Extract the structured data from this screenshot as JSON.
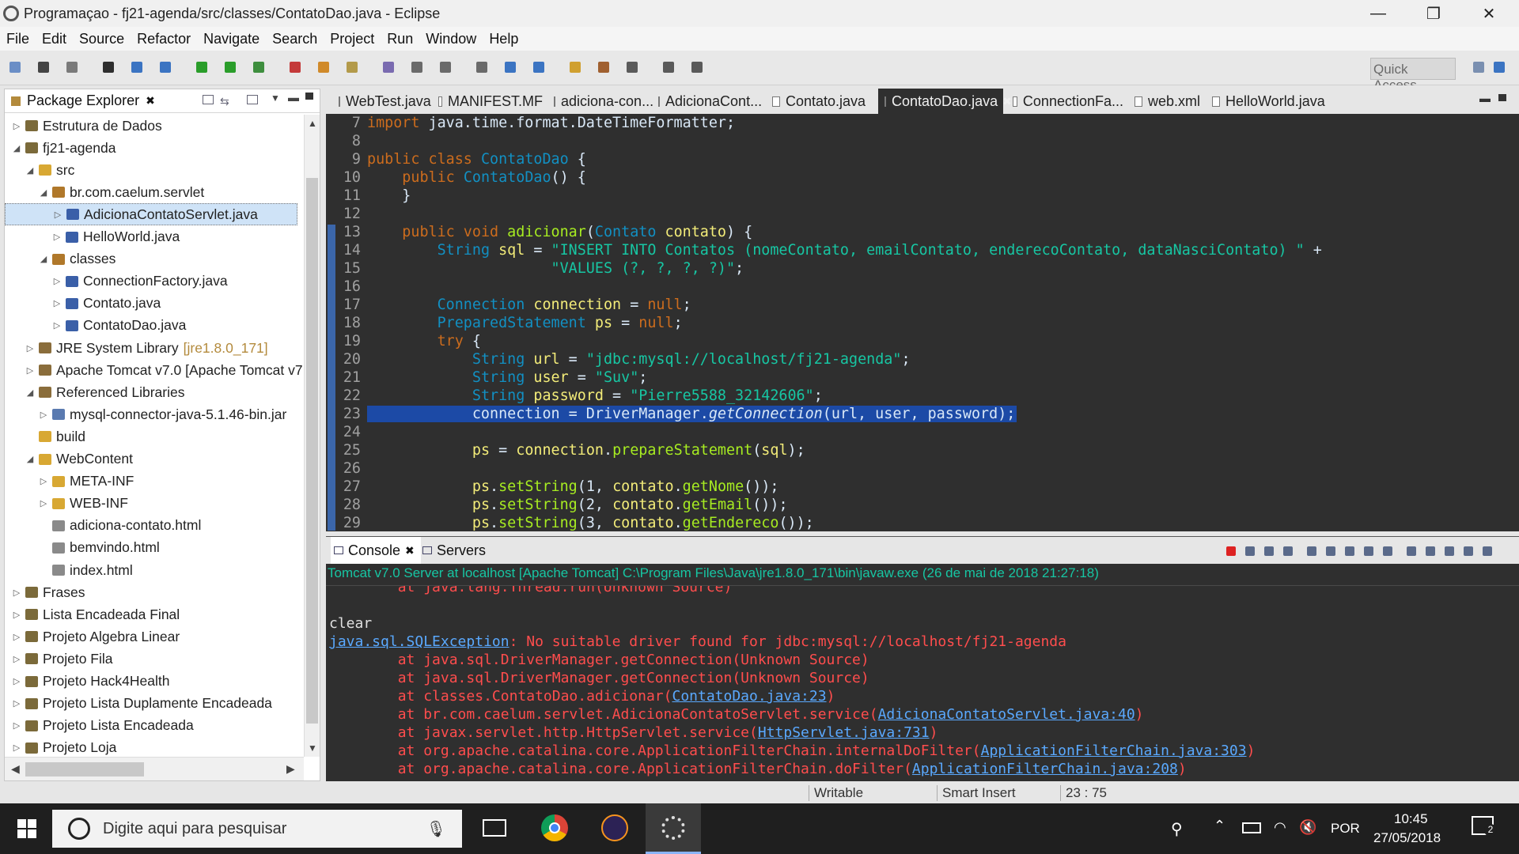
{
  "window": {
    "title": "Programaçao - fj21-agenda/src/classes/ContatoDao.java - Eclipse"
  },
  "menu": [
    "File",
    "Edit",
    "Source",
    "Refactor",
    "Navigate",
    "Search",
    "Project",
    "Run",
    "Window",
    "Help"
  ],
  "toolbar": {
    "quick_access": "Quick Access"
  },
  "package_explorer": {
    "title": "Package Explorer",
    "items": [
      {
        "label": "Estrutura de Dados",
        "indent": 0,
        "arrow": "▷",
        "icon": "project"
      },
      {
        "label": "fj21-agenda",
        "indent": 0,
        "arrow": "◢",
        "icon": "project"
      },
      {
        "label": "src",
        "indent": 1,
        "arrow": "◢",
        "icon": "folder"
      },
      {
        "label": "br.com.caelum.servlet",
        "indent": 2,
        "arrow": "◢",
        "icon": "package"
      },
      {
        "label": "AdicionaContatoServlet.java",
        "indent": 3,
        "arrow": "▷",
        "icon": "java",
        "selected": true
      },
      {
        "label": "HelloWorld.java",
        "indent": 3,
        "arrow": "▷",
        "icon": "java"
      },
      {
        "label": "classes",
        "indent": 2,
        "arrow": "◢",
        "icon": "package"
      },
      {
        "label": "ConnectionFactory.java",
        "indent": 3,
        "arrow": "▷",
        "icon": "java"
      },
      {
        "label": "Contato.java",
        "indent": 3,
        "arrow": "▷",
        "icon": "java"
      },
      {
        "label": "ContatoDao.java",
        "indent": 3,
        "arrow": "▷",
        "icon": "java"
      },
      {
        "label": "JRE System Library",
        "extra": "[jre1.8.0_171]",
        "indent": 1,
        "arrow": "▷",
        "icon": "library"
      },
      {
        "label": "Apache Tomcat v7.0 [Apache Tomcat v7",
        "indent": 1,
        "arrow": "▷",
        "icon": "library"
      },
      {
        "label": "Referenced Libraries",
        "indent": 1,
        "arrow": "◢",
        "icon": "library"
      },
      {
        "label": "mysql-connector-java-5.1.46-bin.jar",
        "indent": 2,
        "arrow": "▷",
        "icon": "jar"
      },
      {
        "label": "build",
        "indent": 1,
        "arrow": "",
        "icon": "folder"
      },
      {
        "label": "WebContent",
        "indent": 1,
        "arrow": "◢",
        "icon": "folder"
      },
      {
        "label": "META-INF",
        "indent": 2,
        "arrow": "▷",
        "icon": "folder"
      },
      {
        "label": "WEB-INF",
        "indent": 2,
        "arrow": "▷",
        "icon": "folder"
      },
      {
        "label": "adiciona-contato.html",
        "indent": 2,
        "arrow": "",
        "icon": "file"
      },
      {
        "label": "bemvindo.html",
        "indent": 2,
        "arrow": "",
        "icon": "file"
      },
      {
        "label": "index.html",
        "indent": 2,
        "arrow": "",
        "icon": "file"
      },
      {
        "label": "Frases",
        "indent": 0,
        "arrow": "▷",
        "icon": "project"
      },
      {
        "label": "Lista Encadeada Final",
        "indent": 0,
        "arrow": "▷",
        "icon": "project"
      },
      {
        "label": "Projeto Algebra Linear",
        "indent": 0,
        "arrow": "▷",
        "icon": "project"
      },
      {
        "label": "Projeto Fila",
        "indent": 0,
        "arrow": "▷",
        "icon": "project"
      },
      {
        "label": "Projeto Hack4Health",
        "indent": 0,
        "arrow": "▷",
        "icon": "project"
      },
      {
        "label": "Projeto Lista Duplamente Encadeada",
        "indent": 0,
        "arrow": "▷",
        "icon": "project"
      },
      {
        "label": "Projeto Lista Encadeada",
        "indent": 0,
        "arrow": "▷",
        "icon": "project"
      },
      {
        "label": "Projeto Loja",
        "indent": 0,
        "arrow": "▷",
        "icon": "project"
      }
    ]
  },
  "editor": {
    "tabs": [
      {
        "label": "WebTest.java"
      },
      {
        "label": "MANIFEST.MF"
      },
      {
        "label": "adiciona-con..."
      },
      {
        "label": "AdicionaCont..."
      },
      {
        "label": "Contato.java"
      },
      {
        "label": "ContatoDao.java",
        "active": true
      },
      {
        "label": "ConnectionFa..."
      },
      {
        "label": "web.xml"
      },
      {
        "label": "HelloWorld.java"
      }
    ],
    "lines": [
      {
        "n": "7",
        "html": "<span class='kw'>import</span> java.time.format.DateTimeFormatter;"
      },
      {
        "n": "8",
        "html": ""
      },
      {
        "n": "9",
        "html": "<span class='kw'>public class</span> <span class='cls'>ContatoDao</span> {"
      },
      {
        "n": "10",
        "html": "    <span class='kw'>public</span> <span class='cls'>ContatoDao</span>() {"
      },
      {
        "n": "11",
        "html": "    }"
      },
      {
        "n": "12",
        "html": ""
      },
      {
        "n": "13",
        "html": "    <span class='kw'>public void</span> <span class='meth'>adicionar</span>(<span class='cls'>Contato</span> <span class='var'>contato</span>) {"
      },
      {
        "n": "14",
        "html": "        <span class='cls'>String</span> <span class='var'>sql</span> = <span class='str'>\"INSERT INTO Contatos (nomeContato, emailContato, enderecoContato, dataNasciContato) \"</span> +"
      },
      {
        "n": "15",
        "html": "                     <span class='str'>\"VALUES (?, ?, ?, ?)\"</span>;"
      },
      {
        "n": "16",
        "html": ""
      },
      {
        "n": "17",
        "html": "        <span class='cls'>Connection</span> <span class='var'>connection</span> = <span class='kw'>null</span>;"
      },
      {
        "n": "18",
        "html": "        <span class='cls'>PreparedStatement</span> <span class='var'>ps</span> = <span class='kw'>null</span>;"
      },
      {
        "n": "19",
        "html": "        <span class='kw'>try</span> {"
      },
      {
        "n": "20",
        "html": "            <span class='cls'>String</span> <span class='var'>url</span> = <span class='str'>\"jdbc:mysql://localhost/fj21-agenda\"</span>;"
      },
      {
        "n": "21",
        "html": "            <span class='cls'>String</span> <span class='var'>user</span> = <span class='str'>\"Suv\"</span>;"
      },
      {
        "n": "22",
        "html": "            <span class='cls'>String</span> <span class='var'>password</span> = <span class='str'>\"Pierre5588_32142606\"</span>;"
      },
      {
        "n": "23",
        "html": "            connection = DriverManager.<span class='it'>getConnection</span>(url, user, password);",
        "hl": true
      },
      {
        "n": "24",
        "html": ""
      },
      {
        "n": "25",
        "html": "            <span class='var'>ps</span> = <span class='var'>connection</span>.<span class='meth'>prepareStatement</span>(<span class='var'>sql</span>);"
      },
      {
        "n": "26",
        "html": ""
      },
      {
        "n": "27",
        "html": "            <span class='var'>ps</span>.<span class='meth'>setString</span>(1, <span class='var'>contato</span>.<span class='meth'>getNome</span>());"
      },
      {
        "n": "28",
        "html": "            <span class='var'>ps</span>.<span class='meth'>setString</span>(2, <span class='var'>contato</span>.<span class='meth'>getEmail</span>());"
      },
      {
        "n": "29",
        "html": "            <span class='var'>ps</span>.<span class='meth'>setString</span>(3, <span class='var'>contato</span>.<span class='meth'>getEndereco</span>());"
      }
    ]
  },
  "console": {
    "tabs": [
      {
        "label": "Console",
        "active": true
      },
      {
        "label": "Servers"
      }
    ],
    "header": "Tomcat v7.0 Server at localhost [Apache Tomcat] C:\\Program Files\\Java\\jre1.8.0_171\\bin\\javaw.exe (26 de mai de 2018 21:27:18)",
    "lines": [
      {
        "html": "<span class='err'>        at java.lang.Thread.run(Unknown Source)</span>"
      },
      {
        "html": ""
      },
      {
        "html": "clear"
      },
      {
        "html": "<span class='lnk'>java.sql.SQLException</span><span class='err'>: No suitable driver found for jdbc:mysql://localhost/fj21-agenda</span>"
      },
      {
        "html": "<span class='err'>        at java.sql.DriverManager.getConnection(Unknown Source)</span>"
      },
      {
        "html": "<span class='err'>        at java.sql.DriverManager.getConnection(Unknown Source)</span>"
      },
      {
        "html": "<span class='err'>        at classes.ContatoDao.adicionar(</span><span class='lnk'>ContatoDao.java:23</span><span class='err'>)</span>"
      },
      {
        "html": "<span class='err'>        at br.com.caelum.servlet.AdicionaContatoServlet.service(</span><span class='lnk'>AdicionaContatoServlet.java:40</span><span class='err'>)</span>"
      },
      {
        "html": "<span class='err'>        at javax.servlet.http.HttpServlet.service(</span><span class='lnk'>HttpServlet.java:731</span><span class='err'>)</span>"
      },
      {
        "html": "<span class='err'>        at org.apache.catalina.core.ApplicationFilterChain.internalDoFilter(</span><span class='lnk'>ApplicationFilterChain.java:303</span><span class='err'>)</span>"
      },
      {
        "html": "<span class='err'>        at org.apache.catalina.core.ApplicationFilterChain.doFilter(</span><span class='lnk'>ApplicationFilterChain.java:208</span><span class='err'>)</span>"
      }
    ]
  },
  "status": {
    "writable": "Writable",
    "insert": "Smart Insert",
    "position": "23 : 75"
  },
  "taskbar": {
    "search_placeholder": "Digite aqui para pesquisar",
    "lang": "POR",
    "time": "10:45",
    "date": "27/05/2018",
    "notifications": "2"
  },
  "colors": {
    "editor_bg": "#2f2f2f",
    "keyword": "#cc6c1d",
    "class": "#1290c3",
    "string": "#17c6a3",
    "error": "#ff4d4d",
    "link": "#5aa9ff",
    "selection": "#1c4aa6"
  }
}
